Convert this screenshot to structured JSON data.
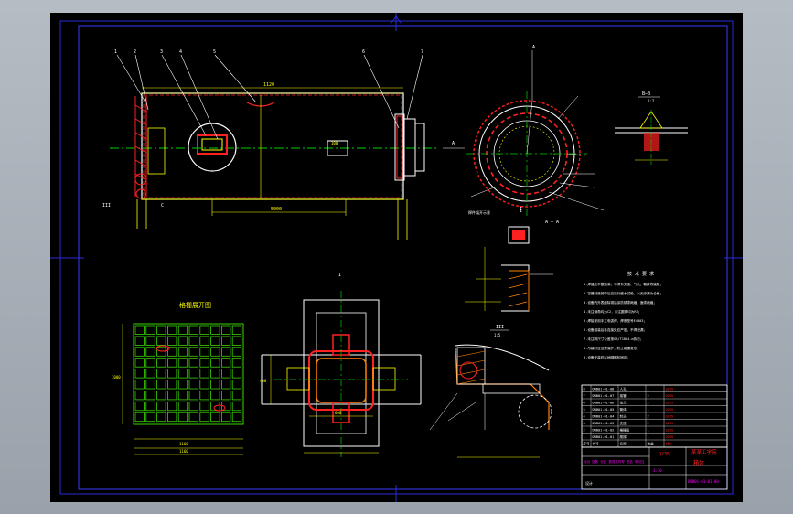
{
  "colors": {
    "background": "#a3a9b2",
    "sheet": "#000000",
    "frame": "#2a2adc",
    "outline": "#ffffff",
    "centerline": "#00d000",
    "dimension": "#ffff00",
    "red": "#ff2020",
    "green_grid": "#39d400",
    "magenta": "#ff00ff",
    "cyan": "#00e5ff"
  },
  "elevation": {
    "dim_top": "1120",
    "dim_bottom": "5000",
    "balloons": [
      "1",
      "2",
      "3",
      "4",
      "5",
      "6",
      "7"
    ],
    "nameplate": "100",
    "tag_A": "A",
    "tag_C": "C",
    "tag_III": "III"
  },
  "plan": {
    "label_section": "A — A",
    "label_I": "I",
    "note": "焊件展开示意",
    "tag_A": "A"
  },
  "section_BB": {
    "title": "B—B",
    "scale": "1:2"
  },
  "detail_I": {
    "title": "I",
    "scale": "1:5"
  },
  "detail_III": {
    "title": "III",
    "scale": "1:5"
  },
  "grid_plate": {
    "title": "格栅展开图",
    "dim_1": "1160",
    "dim_2": "1160",
    "dim_3": "1000"
  },
  "manhole": {
    "label_I": "I",
    "dim_w": "600",
    "dim_h": "400"
  },
  "tech_requirements": {
    "title": "技 术 要 求",
    "lines": [
      "1.焊缝应平整饱满，不得有夹渣、气孔、裂纹等缺陷；",
      "2.容器制造完毕后应进行盛水试验，以无渗漏为合格；",
      "3.设备内外表面除锈后涂防锈漆两遍，面漆两遍；",
      "4.未注倒角均为C2，未注圆角均为R3；",
      "5.焊接采用手工电弧焊，焊条型号E4303；",
      "6.设备组装后各连接处应严密，不得泄漏；",
      "7.未注明尺寸公差按GB/T1804-m执行；",
      "8.吊装时应注意保护，防止碰撞变形；",
      "9.设备安装时以地脚螺栓固定；"
    ]
  },
  "parts_table": {
    "rows": [
      [
        "8",
        "DWB01-01-08",
        "人孔",
        "1",
        "Q235"
      ],
      [
        "7",
        "DWB01-01-07",
        "接管",
        "2",
        "Q235"
      ],
      [
        "6",
        "DWB01-01-06",
        "法兰",
        "2",
        "Q235"
      ],
      [
        "5",
        "DWB01-01-05",
        "筒体",
        "1",
        "Q235"
      ],
      [
        "4",
        "DWB01-01-04",
        "封头",
        "2",
        "Q235"
      ],
      [
        "3",
        "DWB01-01-03",
        "支座",
        "2",
        "Q235"
      ],
      [
        "2",
        "DWB01-01-02",
        "格栅板",
        "1",
        "Q235"
      ],
      [
        "1",
        "DWB01-01-01",
        "爬梯",
        "1",
        "Q235"
      ]
    ],
    "header": [
      "序号",
      "代号",
      "名称",
      "数量",
      "材料"
    ]
  },
  "title_block": {
    "material": "Q235",
    "school": "某某工学院",
    "name": "箱体",
    "drawing_no": "DWB01-01-01-00",
    "left_note": "标记 处数 分区 更改文件号 签名 年月日",
    "design": "设计",
    "scale": "1:10"
  }
}
